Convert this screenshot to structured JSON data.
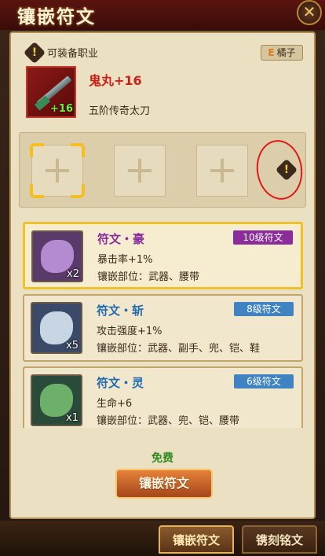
{
  "header": {
    "title": "镶嵌符文"
  },
  "equipment": {
    "requirement_label": "可装备职业",
    "class_grade": "E",
    "class_name": "橘子",
    "weapon_name": "鬼丸+16",
    "weapon_level": "+16",
    "weapon_desc": "五阶传奇太刀"
  },
  "rune_slots": [
    {
      "state": "empty",
      "selected": true
    },
    {
      "state": "empty",
      "selected": false
    },
    {
      "state": "empty",
      "selected": false
    }
  ],
  "runes": [
    {
      "name": "符文・豪",
      "level": "10级符文",
      "stat": "暴击率+1%",
      "slots": "镶嵌部位：武器、腰带",
      "count": "x2",
      "name_color": "#8a2c9a",
      "level_color": "#8a2c9a",
      "stone_color": "#b48ad0",
      "icon_bg": "#5a3a6a"
    },
    {
      "name": "符文・斩",
      "level": "8级符文",
      "stat": "攻击强度+1%",
      "slots": "镶嵌部位：武器、副手、兜、铠、鞋",
      "count": "x5",
      "name_color": "#1f6ab0",
      "level_color": "#3f83c2",
      "stone_color": "#c8d6e4",
      "icon_bg": "#3a4a68"
    },
    {
      "name": "符文・灵",
      "level": "6级符文",
      "stat": "生命+6",
      "slots": "镶嵌部位：武器、兜、铠、腰带",
      "count": "x1",
      "name_color": "#1f6ab0",
      "level_color": "#3f83c2",
      "stone_color": "#6cb06a",
      "icon_bg": "#2a4a3a"
    }
  ],
  "action": {
    "cost_label": "免费",
    "inlay_label": "镶嵌符文"
  },
  "tabs": [
    {
      "label": "镶嵌符文",
      "active": true
    },
    {
      "label": "镌刻铭文",
      "active": false
    }
  ],
  "icons": {
    "close": "close-icon",
    "warning": "warning-icon",
    "plus": "plus-icon"
  }
}
